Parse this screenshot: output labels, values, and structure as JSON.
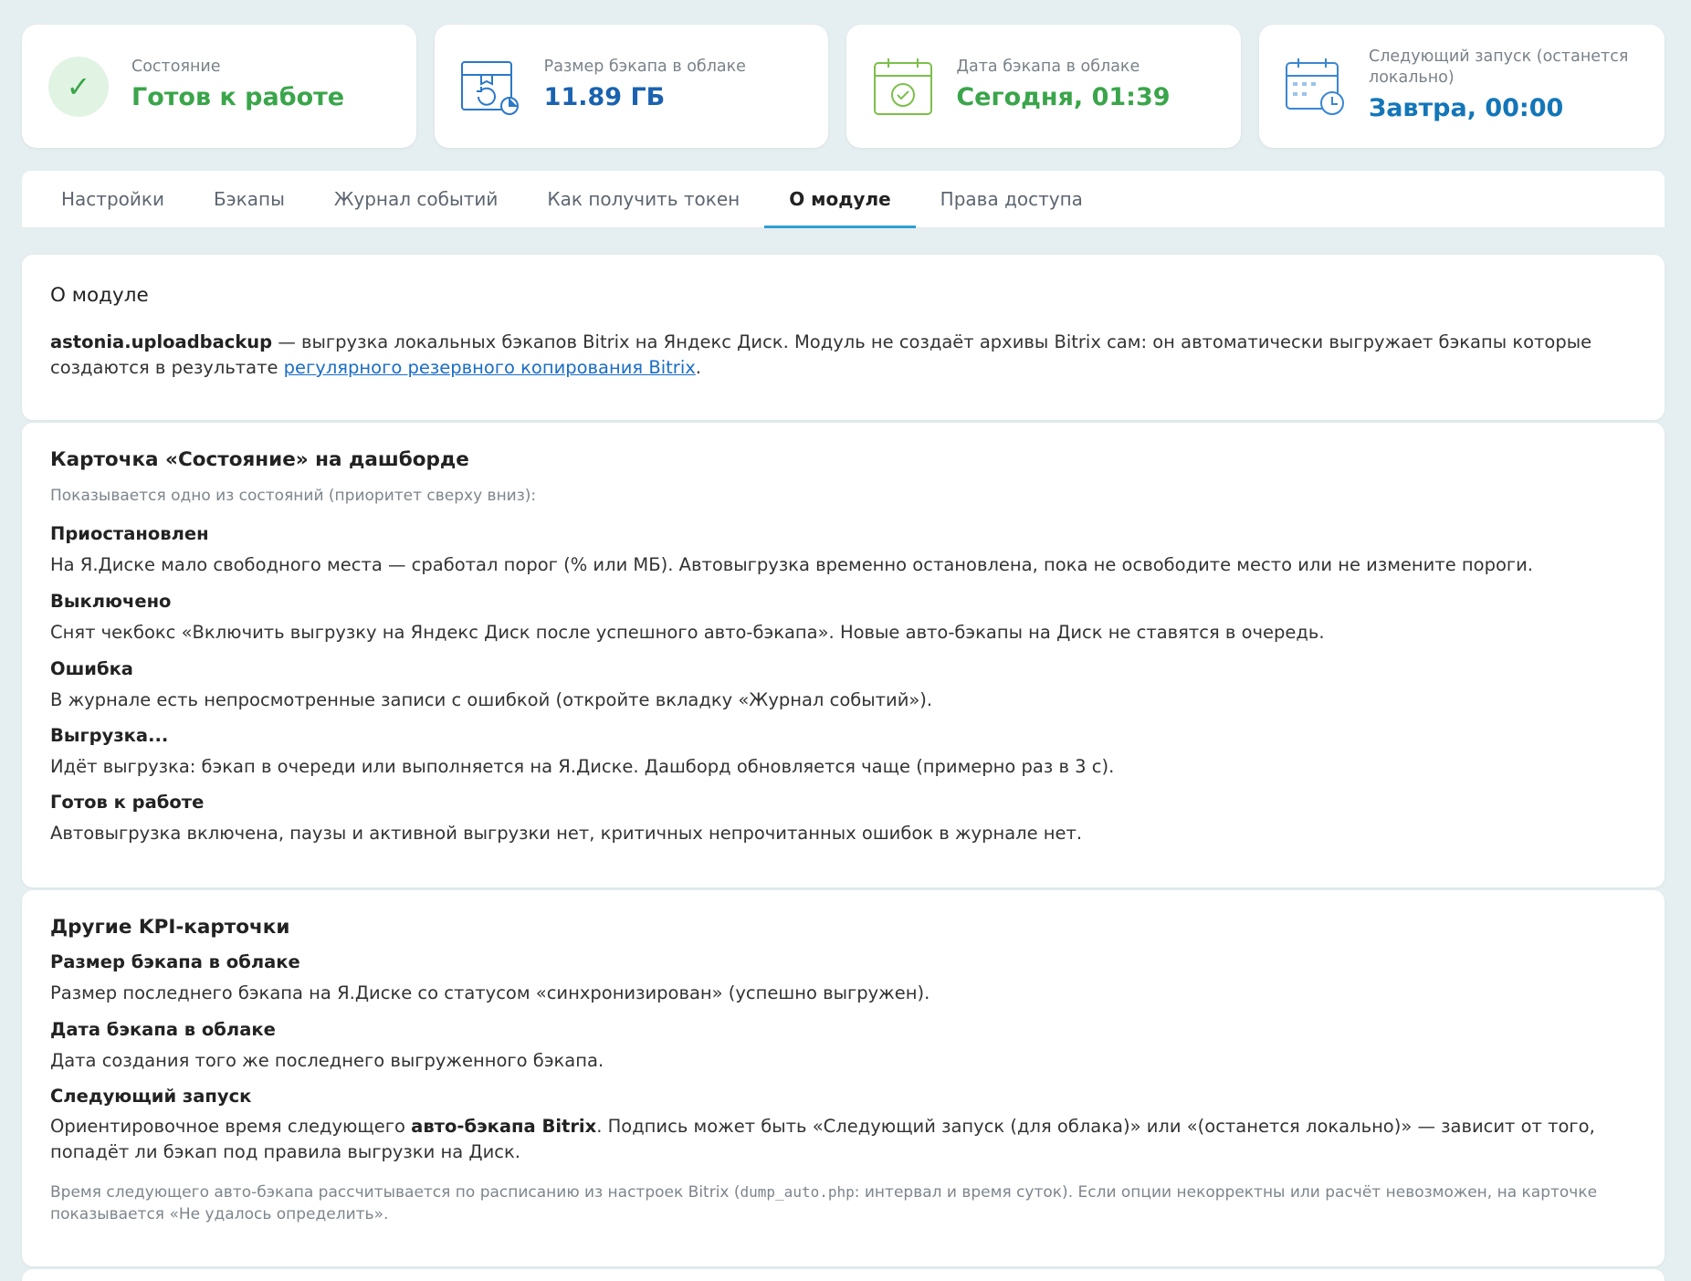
{
  "kpis": [
    {
      "label": "Состояние",
      "value": "Готов к работе",
      "icon": "check-icon"
    },
    {
      "label": "Размер бэкапа в облаке",
      "value": "11.89 ГБ",
      "icon": "cloud-archive-icon"
    },
    {
      "label": "Дата бэкапа в облаке",
      "value": "Сегодня, 01:39",
      "icon": "calendar-check-icon"
    },
    {
      "label": "Следующий запуск (останется локально)",
      "value": "Завтра, 00:00",
      "icon": "calendar-clock-icon"
    }
  ],
  "colors": {
    "green": "#3aa54a",
    "blue": "#1a62b0",
    "accent": "#2e9fd6"
  },
  "tabs": [
    {
      "label": "Настройки"
    },
    {
      "label": "Бэкапы"
    },
    {
      "label": "Журнал событий"
    },
    {
      "label": "Как получить токен"
    },
    {
      "label": "О модуле",
      "active": true
    },
    {
      "label": "Права доступа"
    }
  ],
  "about": {
    "title": "О модуле",
    "module_name": "astonia.uploadbackup",
    "text1": " — выгрузка локальных бэкапов Bitrix на Яндекс Диск. Модуль не создаёт архивы Bitrix сам: он автоматически выгружает бэкапы которые создаются в результате ",
    "link": "регулярного резервного копирования Bitrix",
    "text2": "."
  },
  "state_card": {
    "title": "Карточка «Состояние» на дашборде",
    "hint": "Показывается одно из состояний (приоритет сверху вниз):",
    "items": [
      {
        "title": "Приостановлен",
        "desc": "На Я.Диске мало свободного места — сработал порог (% или МБ). Автовыгрузка временно остановлена, пока не освободите место или не измените пороги."
      },
      {
        "title": "Выключено",
        "desc": "Снят чекбокс «Включить выгрузку на Яндекс Диск после успешного авто-бэкапа». Новые авто-бэкапы на Диск не ставятся в очередь."
      },
      {
        "title": "Ошибка",
        "desc": "В журнале есть непросмотренные записи с ошибкой (откройте вкладку «Журнал событий»)."
      },
      {
        "title": "Выгрузка...",
        "desc": "Идёт выгрузка: бэкап в очереди или выполняется на Я.Диске. Дашборд обновляется чаще (примерно раз в 3 с)."
      },
      {
        "title": "Готов к работе",
        "desc": "Автовыгрузка включена, паузы и активной выгрузки нет, критичных непрочитанных ошибок в журнале нет."
      }
    ]
  },
  "kpi_card": {
    "title": "Другие KPI-карточки",
    "items": [
      {
        "title": "Размер бэкапа в облаке",
        "desc": "Размер последнего бэкапа на Я.Диске со статусом «синхронизирован» (успешно выгружен)."
      },
      {
        "title": "Дата бэкапа в облаке",
        "desc": "Дата создания того же последнего выгруженного бэкапа."
      },
      {
        "title": "Следующий запуск",
        "desc_pre": "Ориентировочное время следующего ",
        "desc_bold": "авто-бэкапа Bitrix",
        "desc_post": ". Подпись может быть «Следующий запуск (для облака)» или «(останется локально)» — зависит от того, попадёт ли бэкап под правила выгрузки на Диск."
      }
    ],
    "note_pre": "Время следующего авто-бэкапа рассчитывается по расписанию из настроек Bitrix (",
    "note_code": "dump_auto.php",
    "note_post": ": интервал и время суток). Если опции некорректны или расчёт невозможен, на карточке показывается «Не удалось определить»."
  }
}
